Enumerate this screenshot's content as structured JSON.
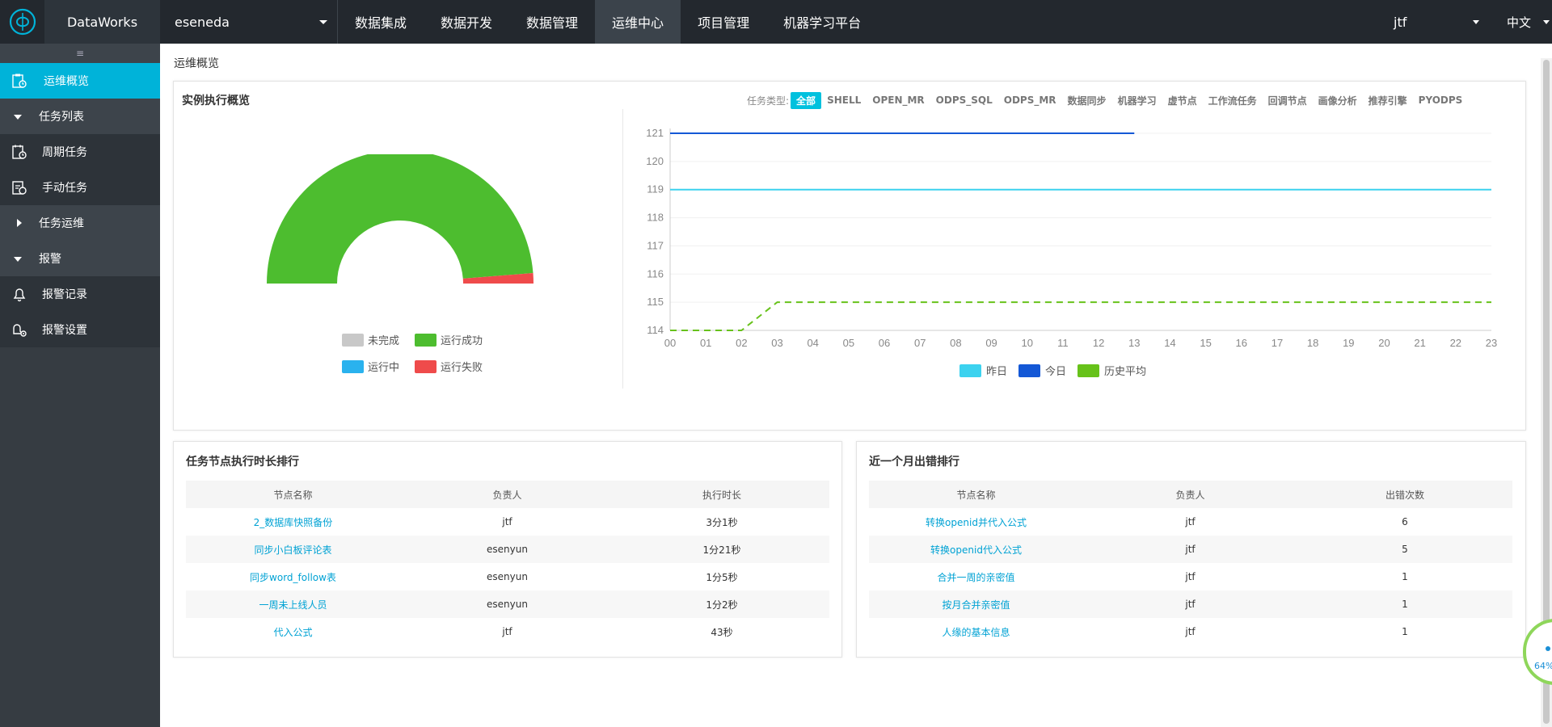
{
  "brand": {
    "name": "DataWorks"
  },
  "project": {
    "name": "eseneda"
  },
  "nav": {
    "items": [
      {
        "label": "数据集成"
      },
      {
        "label": "数据开发"
      },
      {
        "label": "数据管理"
      },
      {
        "label": "运维中心"
      },
      {
        "label": "项目管理"
      },
      {
        "label": "机器学习平台"
      }
    ],
    "active": "运维中心",
    "user": "jtf",
    "language": "中文"
  },
  "sidebar": {
    "items": [
      {
        "label": "运维概览",
        "icon": "clipboard-clock-icon",
        "active": true
      },
      {
        "label": "任务列表",
        "icon": "triangle-down-icon",
        "group": true
      },
      {
        "label": "周期任务",
        "icon": "calendar-clock-icon"
      },
      {
        "label": "手动任务",
        "icon": "hand-task-icon"
      },
      {
        "label": "任务运维",
        "icon": "triangle-right-icon",
        "group": true
      },
      {
        "label": "报警",
        "icon": "triangle-down-icon",
        "group": true
      },
      {
        "label": "报警记录",
        "icon": "bell-icon"
      },
      {
        "label": "报警设置",
        "icon": "bell-settings-icon"
      }
    ]
  },
  "breadcrumb": "运维概览",
  "overview": {
    "title": "实例执行概览",
    "filter_label": "任务类型:",
    "filter_options": [
      "全部",
      "SHELL",
      "OPEN_MR",
      "ODPS_SQL",
      "ODPS_MR",
      "数据同步",
      "机器学习",
      "虚节点",
      "工作流任务",
      "回调节点",
      "画像分析",
      "推荐引擎",
      "PYODPS"
    ],
    "filter_selected": "全部"
  },
  "chart_data": [
    {
      "type": "pie",
      "style": "half-donut",
      "slices": [
        {
          "name": "未完成",
          "value": 0,
          "color": "#c8c8c8"
        },
        {
          "name": "运行成功",
          "value": 97.5,
          "color": "#4dbd2f"
        },
        {
          "name": "运行中",
          "value": 0,
          "color": "#2ab2ee"
        },
        {
          "name": "运行失败",
          "value": 2.5,
          "color": "#ef4b4b"
        }
      ],
      "legend": [
        "未完成",
        "运行成功",
        "运行中",
        "运行失败"
      ]
    },
    {
      "type": "line",
      "x": [
        "00",
        "01",
        "02",
        "03",
        "04",
        "05",
        "06",
        "07",
        "08",
        "09",
        "10",
        "11",
        "12",
        "13",
        "14",
        "15",
        "16",
        "17",
        "18",
        "19",
        "20",
        "21",
        "22",
        "23"
      ],
      "ylim": [
        114,
        121
      ],
      "yticks": [
        114,
        115,
        116,
        117,
        118,
        119,
        120,
        121
      ],
      "series": [
        {
          "name": "昨日",
          "color": "#3cd2ef",
          "dash": false,
          "values": [
            119,
            119,
            119,
            119,
            119,
            119,
            119,
            119,
            119,
            119,
            119,
            119,
            119,
            119,
            119,
            119,
            119,
            119,
            119,
            119,
            119,
            119,
            119,
            119
          ]
        },
        {
          "name": "今日",
          "color": "#1458d6",
          "dash": false,
          "values": [
            121,
            121,
            121,
            121,
            121,
            121,
            121,
            121,
            121,
            121,
            121,
            121,
            121,
            121
          ]
        },
        {
          "name": "历史平均",
          "color": "#67c21a",
          "dash": true,
          "values": [
            114,
            114,
            114,
            115,
            115,
            115,
            115,
            115,
            115,
            115,
            115,
            115,
            115,
            115,
            115,
            115,
            115,
            115,
            115,
            115,
            115,
            115,
            115,
            115
          ]
        }
      ],
      "legend": [
        "昨日",
        "今日",
        "历史平均"
      ]
    }
  ],
  "duration_rank": {
    "title": "任务节点执行时长排行",
    "columns": [
      "节点名称",
      "负责人",
      "执行时长"
    ],
    "rows": [
      [
        "2_数据库快照备份",
        "jtf",
        "3分1秒"
      ],
      [
        "同步小白板评论表",
        "esenyun",
        "1分21秒"
      ],
      [
        "同步word_follow表",
        "esenyun",
        "1分5秒"
      ],
      [
        "一周未上线人员",
        "esenyun",
        "1分2秒"
      ],
      [
        "代入公式",
        "jtf",
        "43秒"
      ]
    ]
  },
  "error_rank": {
    "title": "近一个月出错排行",
    "columns": [
      "节点名称",
      "负责人",
      "出错次数"
    ],
    "rows": [
      [
        "转换openid并代入公式",
        "jtf",
        "6"
      ],
      [
        "转换openid代入公式",
        "jtf",
        "5"
      ],
      [
        "合并一周的亲密值",
        "jtf",
        "1"
      ],
      [
        "按月合并亲密值",
        "jtf",
        "1"
      ],
      [
        "人缘的基本信息",
        "jtf",
        "1"
      ]
    ]
  },
  "float_widget": {
    "percent": "64%"
  }
}
